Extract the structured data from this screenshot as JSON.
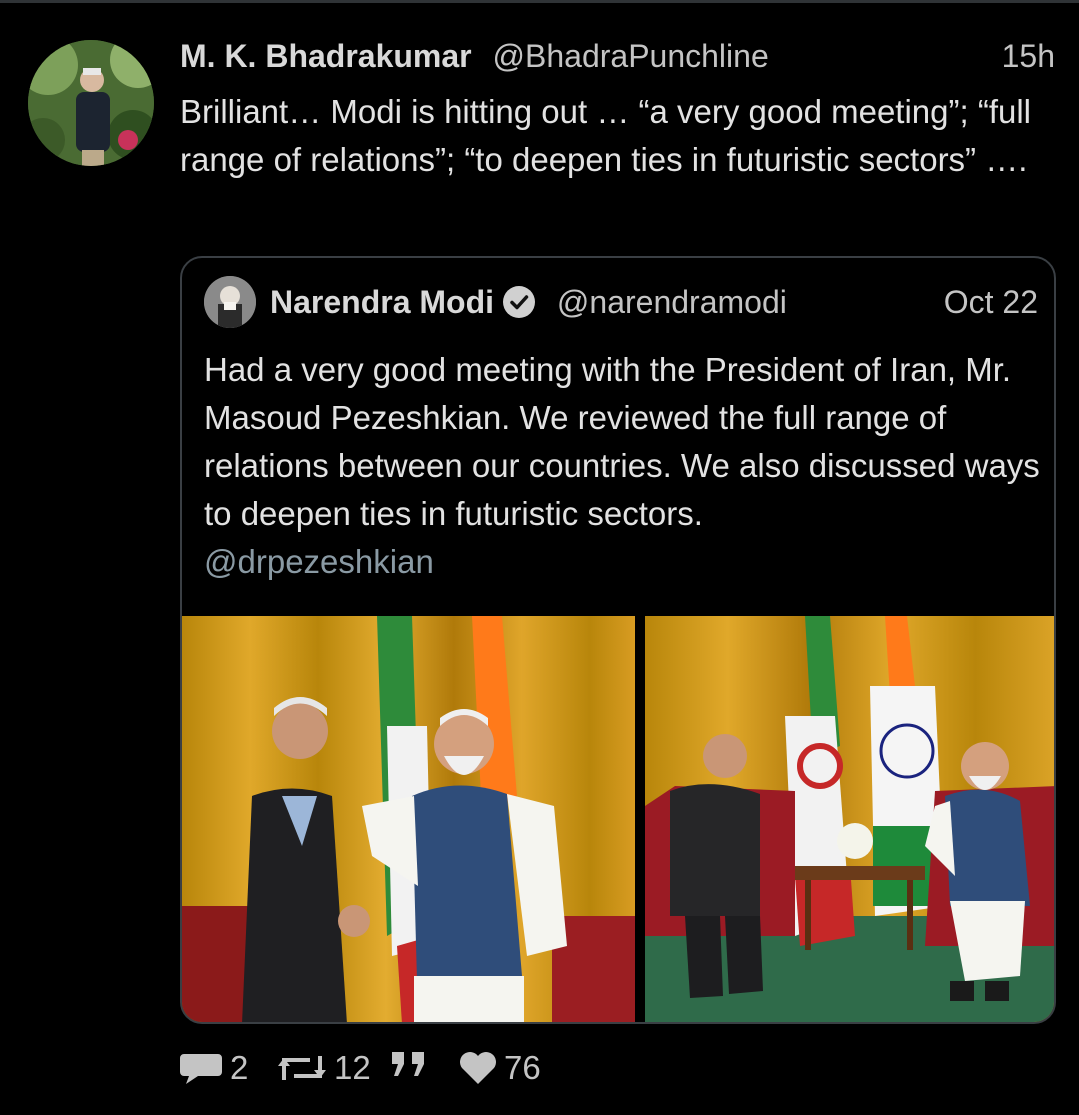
{
  "tweet": {
    "author_name": "M. K. Bhadrakumar",
    "author_handle": "@BhadraPunchline",
    "timestamp": "15h",
    "text": "Brilliant… Modi is hitting out … “a very good meeting”; “full range of relations”; “to deepen ties in futuristic sectors” ….",
    "avatar_icon": "profile-photo"
  },
  "quoted_tweet": {
    "author_name": "Narendra Modi",
    "author_handle": "@narendramodi",
    "date": "Oct 22",
    "verified": true,
    "verified_icon": "verified-badge-icon",
    "text": "Had a very good meeting with the President of Iran, Mr. Masoud Pezeshkian. We reviewed the full range of relations between our countries. We also discussed ways to deepen ties in futuristic sectors.",
    "mention": "@drpezeshkian",
    "photos": [
      "handshake-photo",
      "seated-meeting-photo"
    ]
  },
  "actions": {
    "replies": "2",
    "retweets": "12",
    "likes": "76",
    "reply_icon": "speech-bubble-icon",
    "retweet_icon": "retweet-icon",
    "quote_icon": "quote-icon",
    "like_icon": "heart-icon"
  },
  "colors": {
    "background": "#000000",
    "text": "#e2e2e2",
    "secondary_text": "#c4c4c4",
    "mention": "#8a9aa4",
    "border": "#3a3f44"
  }
}
